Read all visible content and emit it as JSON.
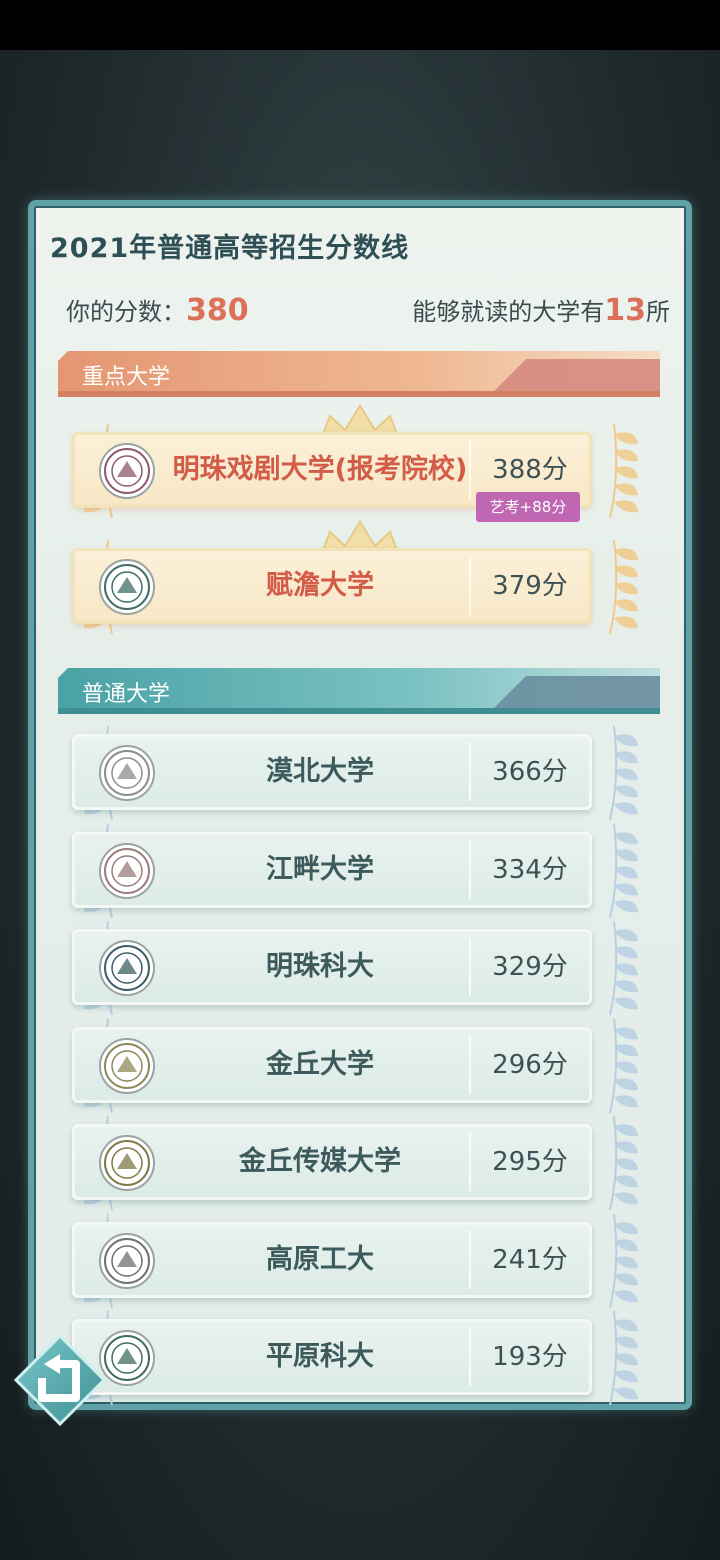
{
  "title": "2021年普通高等招生分数线",
  "score": {
    "label": "你的分数：",
    "value": "380"
  },
  "eligible": {
    "prefix": "能够就读的大学有",
    "count": "13",
    "suffix": "所"
  },
  "sections": {
    "key": "重点大学",
    "normal": "普通大学"
  },
  "key_universities": [
    {
      "name": "明珠戏剧大学(报考院校)",
      "score": "388分",
      "badge": "艺考+88分"
    },
    {
      "name": "赋澹大学",
      "score": "379分"
    }
  ],
  "normal_universities": [
    {
      "name": "漠北大学",
      "score": "366分"
    },
    {
      "name": "江畔大学",
      "score": "334分"
    },
    {
      "name": "明珠科大",
      "score": "329分"
    },
    {
      "name": "金丘大学",
      "score": "296分"
    },
    {
      "name": "金丘传媒大学",
      "score": "295分"
    },
    {
      "name": "高原工大",
      "score": "241分"
    },
    {
      "name": "平原科大",
      "score": "193分"
    }
  ],
  "colors": {
    "accent_score": "#dc7058",
    "key_section": "#e8a07a",
    "normal_section": "#5bb0b2",
    "badge": "#c067b4",
    "panel_border": "#5fa3a8"
  },
  "icons": {
    "back": "back-arrow-icon",
    "laurel": "laurel-wing-icon",
    "crown": "crown-icon"
  }
}
